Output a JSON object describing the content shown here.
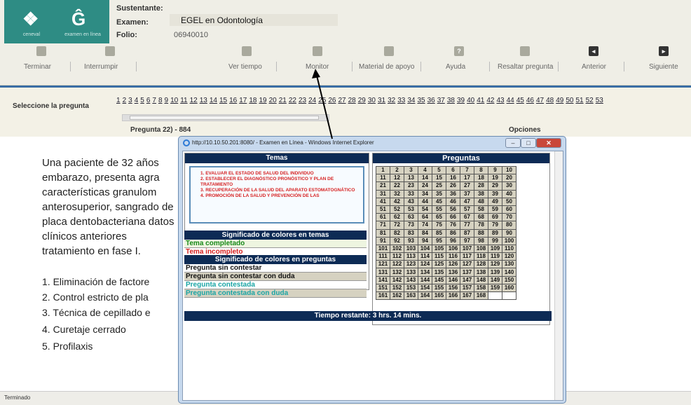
{
  "header": {
    "logo_left_caption": "ceneval",
    "logo_right_caption": "examen en línea",
    "sustentante_label": "Sustentante:",
    "examen_label": "Examen:",
    "examen_value": "EGEL en Odontología",
    "folio_label": "Folio:",
    "folio_value": "06940010"
  },
  "toolbar": {
    "terminar": "Terminar",
    "interrumpir": "Interrumpir",
    "ver_tiempo": "Ver tiempo",
    "monitor": "Monitor",
    "material": "Material de apoyo",
    "ayuda": "Ayuda",
    "resaltar": "Resaltar pregunta",
    "anterior": "Anterior",
    "siguiente": "Siguiente"
  },
  "question_selector": {
    "label": "Seleccione la pregunta",
    "numbers": [
      "1",
      "2",
      "3",
      "4",
      "5",
      "6",
      "7",
      "8",
      "9",
      "10",
      "11",
      "12",
      "13",
      "14",
      "15",
      "16",
      "17",
      "18",
      "19",
      "20",
      "21",
      "22",
      "23",
      "24",
      "25",
      "26",
      "27",
      "28",
      "29",
      "30",
      "31",
      "32",
      "33",
      "34",
      "35",
      "36",
      "37",
      "38",
      "39",
      "40",
      "41",
      "42",
      "43",
      "44",
      "45",
      "46",
      "47",
      "48",
      "49",
      "50",
      "51",
      "52",
      "53"
    ],
    "question_title": "Pregunta 22) - 884",
    "options_title": "Opciones"
  },
  "question": {
    "text": "Una paciente de 32 años embarazo, presenta agra características granulom anterosuperior, sangrado de placa dentobacteriana datos clínicos anteriores tratamiento en fase I.",
    "options": [
      "1. Eliminación de factore",
      "2. Control estricto de pla",
      "3. Técnica de cepillado e",
      "4. Curetaje cerrado",
      "5. Profilaxis"
    ]
  },
  "status_bar": {
    "text": "Terminado"
  },
  "popup": {
    "title": "http://10.10.50.201:8080/ - Examen en Línea - Windows Internet Explorer",
    "temas_head": "Temas",
    "topics": [
      "1. EVALUAR EL ESTADO DE SALUD DEL INDIVIDUO",
      "2. ESTABLECER EL DIAGNÓSTICO PRONÓSTICO Y PLAN DE TRATAMIENTO",
      "3. RECUPERACIÓN DE LA SALUD DEL APARATO ESTOMATOGNÁTICO",
      "4. PROMOCIÓN DE LA SALUD Y PREVENCIÓN DE LAS"
    ],
    "sig_temas": "Significado de colores en temas",
    "tema_completado": "Tema completado",
    "tema_incompleto": "Tema incompleto",
    "sig_preguntas": "Significado de colores en preguntas",
    "p_sin_contestar": "Pregunta sin contestar",
    "p_sin_contestar_duda": "Pregunta sin contestar con duda",
    "p_contestada": "Pregunta contestada",
    "p_contestada_duda": "Pregunta contestada con duda",
    "preguntas_head": "Preguntas",
    "total_questions": 168,
    "tiempo": "Tiempo restante: 3 hrs. 14 mins.",
    "colors": {
      "completed": "#1a8a1a",
      "incomplete": "#d62020",
      "answered": "#1aa5a5",
      "header": "#0d2b55"
    }
  }
}
